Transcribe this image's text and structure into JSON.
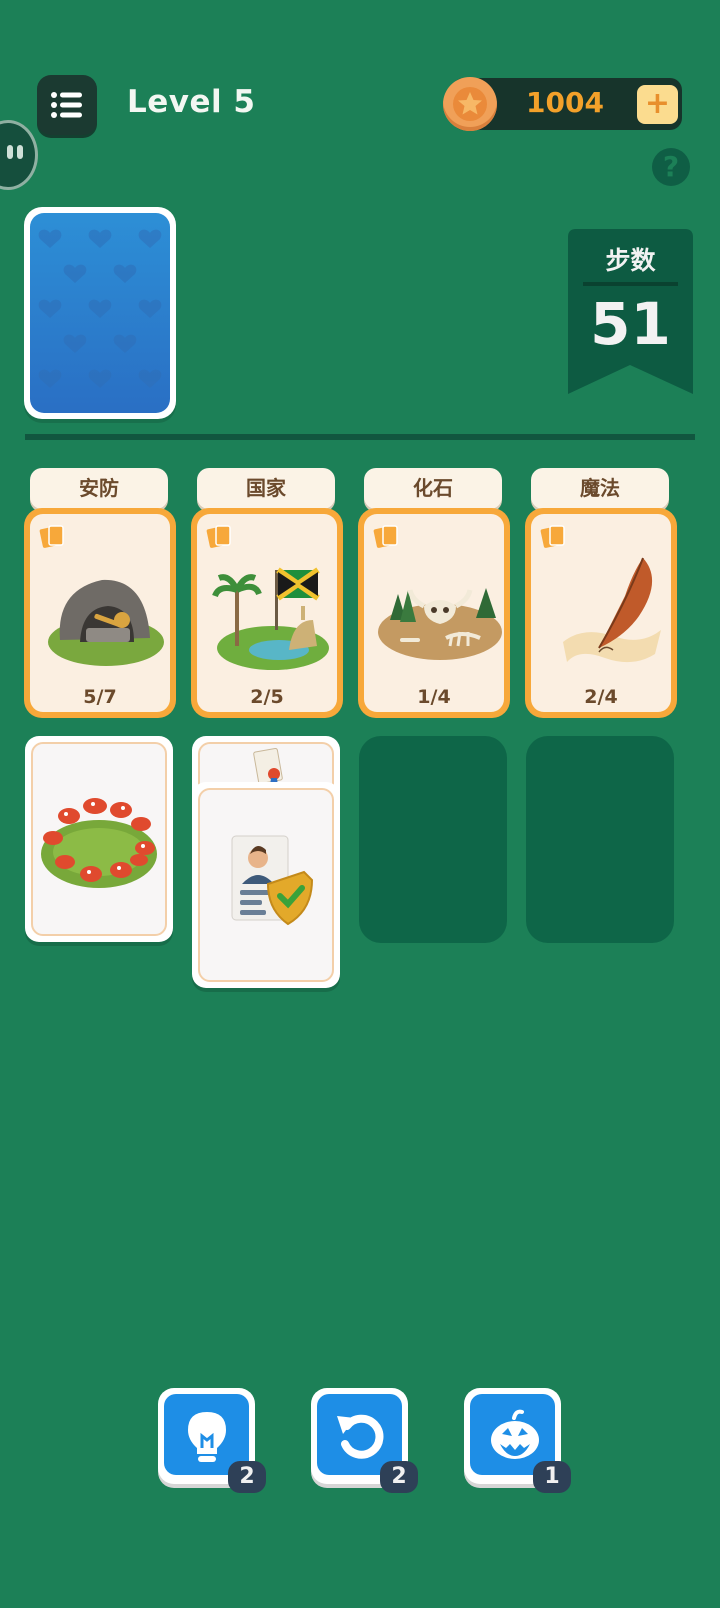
{
  "header": {
    "level_title": "Level 5",
    "coins": "1004",
    "add_coins_label": "+",
    "help_label": "?"
  },
  "steps": {
    "label": "步数",
    "value": "51"
  },
  "categories": [
    {
      "name": "安防",
      "progress": "5/7",
      "icon": "key-cave-icon"
    },
    {
      "name": "国家",
      "progress": "2/5",
      "icon": "jamaica-island-icon"
    },
    {
      "name": "化石",
      "progress": "1/4",
      "icon": "skeleton-fossil-icon"
    },
    {
      "name": "魔法",
      "progress": "2/4",
      "icon": "quill-scroll-icon"
    }
  ],
  "board_cards": [
    {
      "icon": "mushroom-ring-icon"
    },
    {
      "icon": "certificate-icon"
    },
    {
      "icon": "id-card-shield-icon"
    }
  ],
  "tools": [
    {
      "name": "hint",
      "icon": "lightbulb-icon",
      "count": "2"
    },
    {
      "name": "undo",
      "icon": "undo-icon",
      "count": "2"
    },
    {
      "name": "pumpkin",
      "icon": "pumpkin-icon",
      "count": "1"
    }
  ],
  "colors": {
    "background": "#1c8057",
    "card_border_active": "#f7a83a",
    "coin_text": "#f3a12a",
    "tool_blue": "#1e8ee6"
  }
}
